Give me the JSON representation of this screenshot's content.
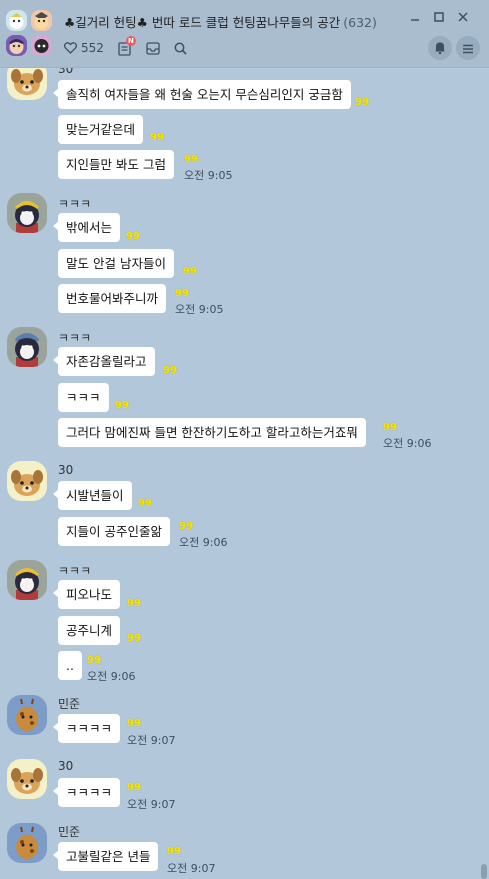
{
  "header": {
    "title": "♣길거리 헌팅♣ 번따 로드 클럽 헌팅꿈나무들의 공간",
    "participants": "(632)",
    "likes": "552",
    "notice_badge": "N",
    "icons": [
      "heart-icon",
      "notice-icon",
      "inbox-icon",
      "search-icon",
      "bell-icon",
      "menu-icon",
      "minimize-icon",
      "maximize-icon",
      "close-icon"
    ],
    "colors": {
      "header_bg": "#a9bdcf",
      "chat_bg": "#b2c7da",
      "unread": "#f7e600",
      "badge": "#f25a5a"
    }
  },
  "messages": [
    {
      "sender": "30",
      "text": "솔직히 여자들을 왜 헌술 오는지 무슨심리인지 궁금함",
      "unread": "99",
      "time": ""
    },
    {
      "sender": "",
      "text": "맞는거같은데",
      "unread": "99",
      "time": ""
    },
    {
      "sender": "",
      "text": "지인들만 봐도 그럼",
      "unread": "99",
      "time": "오전 9:05"
    },
    {
      "sender": "ㅋㅋㅋ",
      "text": "밖에서는",
      "unread": "99",
      "time": ""
    },
    {
      "sender": "",
      "text": "말도 안걸 남자들이",
      "unread": "99",
      "time": ""
    },
    {
      "sender": "",
      "text": "번호물어봐주니까",
      "unread": "99",
      "time": "오전 9:05"
    },
    {
      "sender": "ㅋㅋㅋ",
      "text": "자존감올릴라고",
      "unread": "99",
      "time": ""
    },
    {
      "sender": "",
      "text": "ㅋㅋㅋ",
      "unread": "99",
      "time": ""
    },
    {
      "sender": "",
      "text": "그러다 맘에진짜 들면 한잔하기도하고 할라고하는거죠뭐",
      "unread": "99",
      "time": "오전 9:06"
    },
    {
      "sender": "30",
      "text": "시발년들이",
      "unread": "99",
      "time": ""
    },
    {
      "sender": "",
      "text": "지들이 공주인줄앎",
      "unread": "99",
      "time": "오전 9:06"
    },
    {
      "sender": "ㅋㅋㅋ",
      "text": "피오나도",
      "unread": "99",
      "time": ""
    },
    {
      "sender": "",
      "text": "공주니계",
      "unread": "99",
      "time": ""
    },
    {
      "sender": "",
      "text": "..",
      "unread": "99",
      "time": "오전 9:06"
    },
    {
      "sender": "민준",
      "text": "ㅋㅋㅋㅋ",
      "unread": "99",
      "time": "오전 9:07"
    },
    {
      "sender": "30",
      "text": "ㅋㅋㅋㅋ",
      "unread": "99",
      "time": "오전 9:07"
    },
    {
      "sender": "민준",
      "text": "고불릴같은 년들",
      "unread": "99",
      "time": "오전 9:07"
    }
  ]
}
